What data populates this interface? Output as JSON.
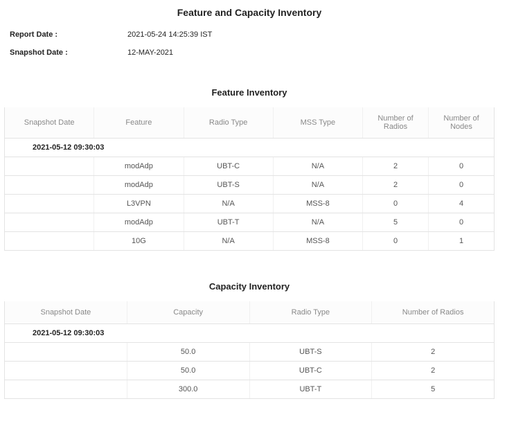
{
  "heading": "Feature and Capacity Inventory",
  "meta": {
    "report_label": "Report Date :",
    "report_value": "2021-05-24 14:25:39 IST",
    "snapshot_label": "Snapshot Date :",
    "snapshot_value": "12-MAY-2021"
  },
  "feature_section_title": "Feature Inventory",
  "feature_headers": {
    "snapshot": "Snapshot Date",
    "feature": "Feature",
    "radio_type": "Radio Type",
    "mss_type": "MSS Type",
    "num_radios": "Number of Radios",
    "num_nodes": "Number of Nodes"
  },
  "feature_group": "2021-05-12 09:30:03",
  "feature_rows": [
    {
      "feature": "modAdp",
      "radio_type": "UBT-C",
      "mss_type": "N/A",
      "num_radios": "2",
      "num_nodes": "0"
    },
    {
      "feature": "modAdp",
      "radio_type": "UBT-S",
      "mss_type": "N/A",
      "num_radios": "2",
      "num_nodes": "0"
    },
    {
      "feature": "L3VPN",
      "radio_type": "N/A",
      "mss_type": "MSS-8",
      "num_radios": "0",
      "num_nodes": "4"
    },
    {
      "feature": "modAdp",
      "radio_type": "UBT-T",
      "mss_type": "N/A",
      "num_radios": "5",
      "num_nodes": "0"
    },
    {
      "feature": "10G",
      "radio_type": "N/A",
      "mss_type": "MSS-8",
      "num_radios": "0",
      "num_nodes": "1"
    }
  ],
  "capacity_section_title": "Capacity Inventory",
  "capacity_headers": {
    "snapshot": "Snapshot Date",
    "capacity": "Capacity",
    "radio_type": "Radio Type",
    "num_radios": "Number of Radios"
  },
  "capacity_group": "2021-05-12 09:30:03",
  "capacity_rows": [
    {
      "capacity": "50.0",
      "radio_type": "UBT-S",
      "num_radios": "2"
    },
    {
      "capacity": "50.0",
      "radio_type": "UBT-C",
      "num_radios": "2"
    },
    {
      "capacity": "300.0",
      "radio_type": "UBT-T",
      "num_radios": "5"
    }
  ]
}
